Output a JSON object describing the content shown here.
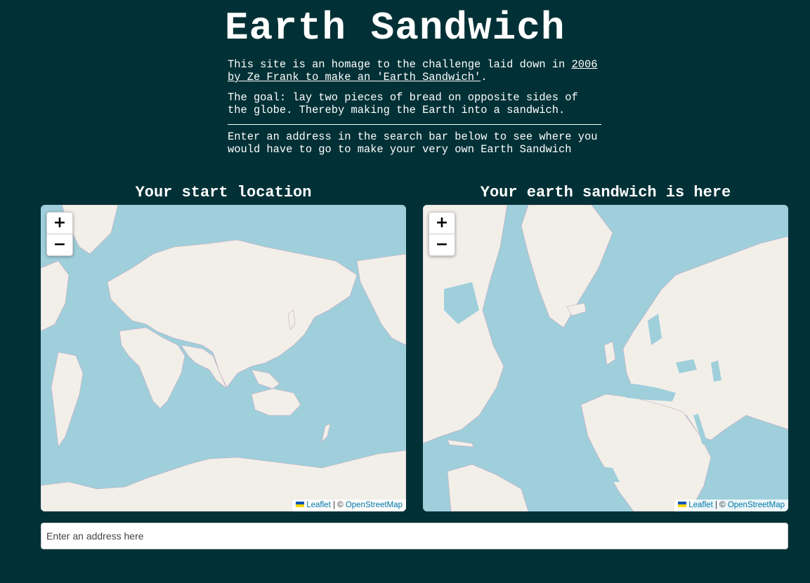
{
  "header": {
    "title": "Earth Sandwich",
    "intro_before": "This site is an homage to the challenge laid down in ",
    "intro_link": "2006 by Ze Frank to make an 'Earth Sandwich'",
    "intro_after": ".",
    "goal": "The goal: lay two pieces of bread on opposite sides of the globe. Thereby making the Earth into a sandwich.",
    "instructions": "Enter an address in the search bar below to see where you would have to go to make your very own Earth Sandwich"
  },
  "maps": {
    "start": {
      "title": "Your start location"
    },
    "sandwich": {
      "title": "Your earth sandwich is here"
    },
    "zoom_in": "+",
    "zoom_out": "−",
    "attribution": {
      "leaflet": "Leaflet",
      "separator": " | © ",
      "osm": "OpenStreetMap"
    }
  },
  "search": {
    "placeholder": "Enter an address here",
    "value": ""
  },
  "colors": {
    "background": "#013136",
    "water": "#9fcfdb",
    "land": "#f2efe9",
    "border": "#c9a8c0",
    "link": "#0078a8"
  },
  "icons": {
    "zoom_in": "plus-icon",
    "zoom_out": "minus-icon",
    "flag": "ukraine-flag-icon"
  }
}
